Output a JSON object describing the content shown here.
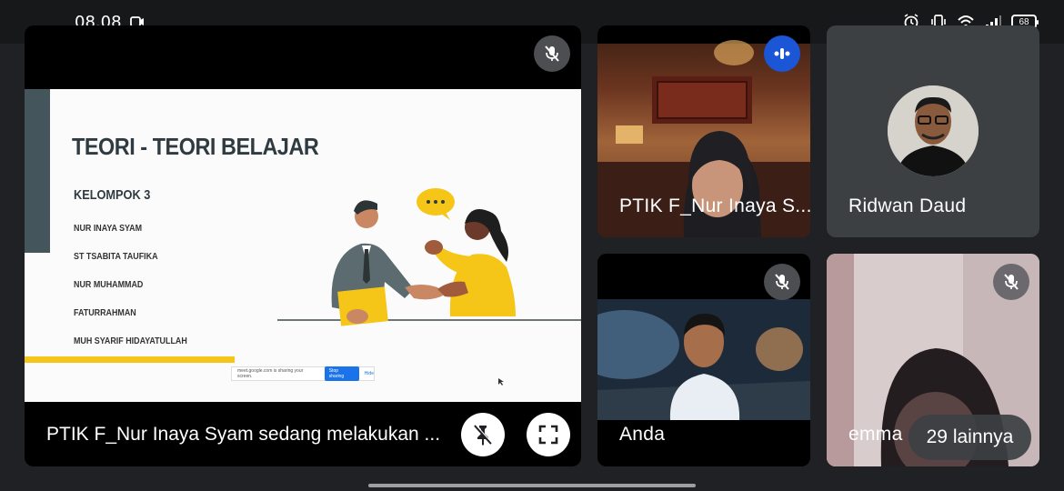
{
  "status_bar": {
    "time": "08.08",
    "battery": "68"
  },
  "main_tile": {
    "caption": "PTIK F_Nur Inaya Syam sedang melakukan ...",
    "slide": {
      "title": "TEORI - TEORI BELAJAR",
      "subtitle": "KELOMPOK 3",
      "members": [
        "NUR INAYA SYAM",
        "ST TSABITA TAUFIKA",
        "NUR MUHAMMAD",
        "FATURRAHMAN",
        "MUH SYARIF HIDAYATULLAH"
      ],
      "share_text": "meet.google.com is sharing your screen.",
      "stop_label": "Stop sharing",
      "hide_label": "Hide"
    }
  },
  "participants": [
    {
      "name": "PTIK F_Nur Inaya S...",
      "state": "speaking"
    },
    {
      "name": "Ridwan Daud",
      "state": "muted-unknown"
    },
    {
      "name": "Anda",
      "state": "muted"
    },
    {
      "name": "emma",
      "state": "muted"
    }
  ],
  "more_participants": "29 lainnya",
  "colors": {
    "background": "#202124",
    "accent_blue": "#1a73e8",
    "slide_yellow": "#f5c518"
  }
}
